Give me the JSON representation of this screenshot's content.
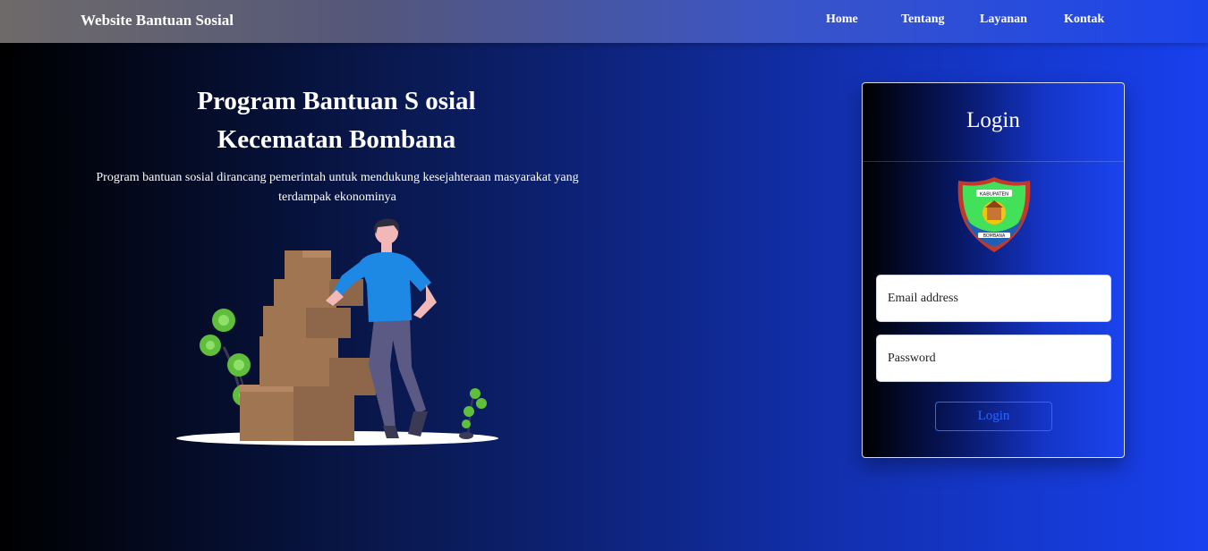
{
  "navbar": {
    "brand": "Website Bantuan Sosial",
    "links": [
      {
        "label": "Home"
      },
      {
        "label": "Tentang"
      },
      {
        "label": "Layanan"
      },
      {
        "label": "Kontak"
      }
    ]
  },
  "hero": {
    "title_line1": "Program Bantuan S osial",
    "title_line2": "Kecematan Bombana",
    "description": "Program bantuan sosial dirancang pemerintah untuk mendukung kesejahteraan masyarakat yang terdampak ekonominya",
    "illustration_icon": "delivery-person-with-boxes-illustration"
  },
  "login": {
    "title": "Login",
    "logo": {
      "icon": "kabupaten-bombana-emblem",
      "top_text": "KABUPATEN",
      "bottom_text": "BOMBANA"
    },
    "email_placeholder": "Email address",
    "password_placeholder": "Password",
    "button_label": "Login"
  },
  "colors": {
    "accent": "#2b66ff",
    "background_start": "#000000",
    "background_end": "#1840ee",
    "emblem_green": "#43e05a",
    "emblem_red": "#c0392b"
  }
}
